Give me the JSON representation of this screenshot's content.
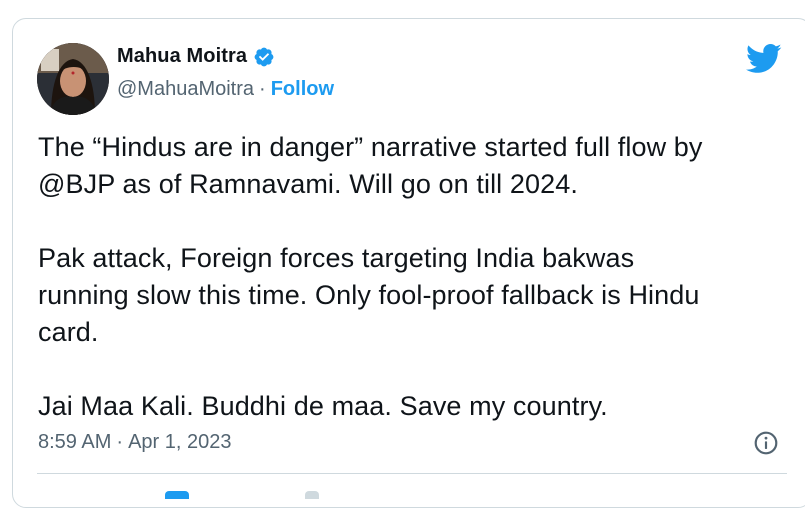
{
  "author": {
    "display_name": "Mahua Moitra",
    "handle": "@MahuaMoitra",
    "separator": "·",
    "follow_label": "Follow",
    "verified": true
  },
  "tweet": {
    "paragraphs": [
      "The “Hindus are in danger” narrative started full flow by\n@BJP as of Ramnavami. Will go on till 2024.",
      "Pak attack, Foreign forces targeting India bakwas\nrunning slow this time. Only fool-proof fallback is Hindu\ncard.",
      "Jai Maa Kali. Buddhi de maa. Save my country."
    ],
    "time": "8:59 AM",
    "meta_separator": "·",
    "date": "Apr 1, 2023"
  },
  "icons": {
    "platform": "twitter-bird-icon",
    "verified": "verified-badge-icon",
    "info": "info-icon"
  },
  "colors": {
    "brand_blue": "#1d9bf0",
    "text_primary": "#0f1419",
    "text_secondary": "#536471",
    "border": "#cfd9de"
  }
}
